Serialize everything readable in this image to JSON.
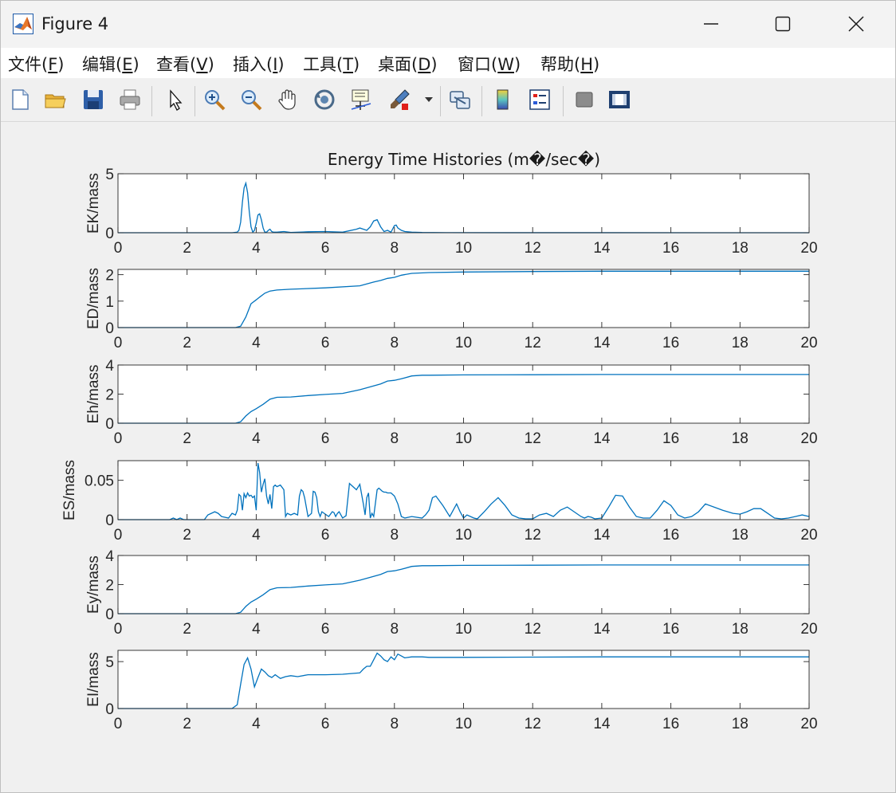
{
  "window": {
    "title": "Figure 4",
    "minimize_icon": "minimize-icon",
    "maximize_icon": "maximize-icon",
    "close_icon": "close-icon"
  },
  "menu": {
    "items": [
      {
        "label": "文件(F)",
        "text": "文件(",
        "key": "F"
      },
      {
        "label": "编辑(E)",
        "text": "编辑(",
        "key": "E"
      },
      {
        "label": "查看(V)",
        "text": "查看(",
        "key": "V"
      },
      {
        "label": "插入(I)",
        "text": "插入(",
        "key": "I"
      },
      {
        "label": "工具(T)",
        "text": "工具(",
        "key": "T"
      },
      {
        "label": "桌面(D)",
        "text": "桌面(",
        "key": "D"
      },
      {
        "label": "窗口(W)",
        "text": "窗口(",
        "key": "W"
      },
      {
        "label": "帮助(H)",
        "text": "帮助(",
        "key": "H"
      }
    ],
    "close_paren": ")",
    "dock_arrow": "↘"
  },
  "toolbar": {
    "icons": [
      "new-figure-icon",
      "open-file-icon",
      "save-icon",
      "print-icon",
      "select-pointer-icon",
      "zoom-in-icon",
      "zoom-out-icon",
      "pan-hand-icon",
      "rotate-3d-icon",
      "data-cursor-icon",
      "brush-icon",
      "link-plot-icon",
      "colorbar-icon",
      "legend-icon",
      "hide-plot-tools-icon",
      "show-plot-tools-icon"
    ]
  },
  "colors": {
    "line": "#0072bd",
    "axes_background": "#ffffff",
    "figure_background": "#f0f0f0",
    "axis": "#262626"
  },
  "chart_data": {
    "type": "line",
    "title": "Energy Time Histories (m�/sec�)",
    "panels": [
      {
        "ylabel": "EK/mass",
        "xlim": [
          0,
          20
        ],
        "ylim": [
          0,
          5
        ],
        "xticks": [
          0,
          2,
          4,
          6,
          8,
          10,
          12,
          14,
          16,
          18,
          20
        ],
        "yticks": [
          0,
          5
        ],
        "ytick_labels": [
          "0",
          "5"
        ],
        "x": [
          0,
          3.3,
          3.45,
          3.5,
          3.55,
          3.6,
          3.65,
          3.7,
          3.75,
          3.8,
          3.85,
          3.9,
          3.95,
          4.0,
          4.05,
          4.1,
          4.15,
          4.2,
          4.25,
          4.3,
          4.35,
          4.4,
          4.45,
          4.5,
          4.6,
          4.8,
          5.0,
          5.5,
          6.0,
          6.5,
          6.9,
          7.0,
          7.2,
          7.3,
          7.4,
          7.5,
          7.6,
          7.7,
          7.8,
          7.9,
          8.0,
          8.05,
          8.1,
          8.2,
          8.3,
          8.5,
          8.8,
          9.5,
          20
        ],
        "y": [
          0,
          0,
          0.05,
          0.2,
          0.9,
          2.6,
          3.8,
          4.2,
          3.4,
          1.8,
          0.5,
          0.05,
          0.2,
          0.8,
          1.5,
          1.6,
          1.1,
          0.4,
          0.05,
          0.05,
          0.2,
          0.3,
          0.1,
          0.05,
          0.05,
          0.1,
          0.03,
          0.08,
          0.1,
          0.05,
          0.3,
          0.4,
          0.2,
          0.5,
          1.0,
          1.1,
          0.5,
          0.1,
          0.2,
          0.05,
          0.6,
          0.65,
          0.4,
          0.2,
          0.1,
          0.05,
          0.02,
          0.01,
          0
        ]
      },
      {
        "ylabel": "ED/mass",
        "xlim": [
          0,
          20
        ],
        "ylim": [
          0,
          2.2
        ],
        "xticks": [
          0,
          2,
          4,
          6,
          8,
          10,
          12,
          14,
          16,
          18,
          20
        ],
        "yticks": [
          0,
          1,
          2
        ],
        "ytick_labels": [
          "0",
          "1",
          "2"
        ],
        "x": [
          0,
          3.4,
          3.55,
          3.7,
          3.85,
          4.0,
          4.1,
          4.25,
          4.4,
          4.6,
          5.0,
          6.0,
          7.0,
          7.2,
          7.4,
          7.6,
          7.8,
          8.0,
          8.2,
          8.5,
          9.0,
          10.0,
          12.0,
          14.0,
          20
        ],
        "y": [
          0,
          0,
          0.05,
          0.4,
          0.9,
          1.05,
          1.15,
          1.3,
          1.38,
          1.42,
          1.45,
          1.5,
          1.58,
          1.65,
          1.72,
          1.78,
          1.86,
          1.9,
          1.98,
          2.05,
          2.08,
          2.1,
          2.12,
          2.13,
          2.13
        ]
      },
      {
        "ylabel": "Eh/mass",
        "xlim": [
          0,
          20
        ],
        "ylim": [
          0,
          4
        ],
        "xticks": [
          0,
          2,
          4,
          6,
          8,
          10,
          12,
          14,
          16,
          18,
          20
        ],
        "yticks": [
          0,
          2,
          4
        ],
        "ytick_labels": [
          "0",
          "2",
          "4"
        ],
        "x": [
          0,
          3.4,
          3.55,
          3.7,
          3.85,
          4.0,
          4.2,
          4.4,
          4.6,
          5.0,
          5.5,
          6.0,
          6.5,
          7.0,
          7.3,
          7.6,
          7.8,
          8.0,
          8.2,
          8.5,
          8.8,
          9.0,
          10.0,
          12.0,
          14.0,
          20
        ],
        "y": [
          0,
          0,
          0.1,
          0.5,
          0.8,
          1.0,
          1.3,
          1.65,
          1.78,
          1.8,
          1.9,
          1.98,
          2.05,
          2.3,
          2.5,
          2.7,
          2.9,
          2.95,
          3.05,
          3.25,
          3.3,
          3.3,
          3.32,
          3.33,
          3.35,
          3.35
        ]
      },
      {
        "ylabel": "ES/mass",
        "xlim": [
          0,
          20
        ],
        "ylim": [
          0,
          0.075
        ],
        "xticks": [
          0,
          2,
          4,
          6,
          8,
          10,
          12,
          14,
          16,
          18,
          20
        ],
        "yticks": [
          0,
          0.05
        ],
        "ytick_labels": [
          "0",
          "0.05"
        ],
        "x": [
          0,
          1.5,
          1.6,
          1.7,
          1.8,
          1.9,
          2.5,
          2.6,
          2.8,
          2.9,
          3.0,
          3.2,
          3.3,
          3.4,
          3.45,
          3.5,
          3.55,
          3.6,
          3.65,
          3.7,
          3.75,
          3.8,
          3.85,
          3.9,
          3.95,
          4.0,
          4.05,
          4.1,
          4.15,
          4.2,
          4.25,
          4.3,
          4.35,
          4.4,
          4.45,
          4.5,
          4.55,
          4.6,
          4.7,
          4.8,
          4.85,
          4.9,
          5.0,
          5.1,
          5.2,
          5.25,
          5.3,
          5.35,
          5.4,
          5.5,
          5.6,
          5.65,
          5.7,
          5.75,
          5.8,
          5.85,
          5.9,
          6.0,
          6.1,
          6.2,
          6.25,
          6.3,
          6.35,
          6.4,
          6.5,
          6.6,
          6.7,
          6.75,
          6.8,
          6.9,
          7.0,
          7.1,
          7.15,
          7.2,
          7.25,
          7.3,
          7.35,
          7.4,
          7.5,
          7.55,
          7.6,
          7.65,
          7.7,
          7.75,
          7.8,
          7.9,
          8.0,
          8.1,
          8.2,
          8.3,
          8.5,
          8.8,
          8.9,
          9.0,
          9.1,
          9.2,
          9.4,
          9.6,
          9.7,
          9.8,
          9.9,
          10.0,
          10.1,
          10.2,
          10.3,
          10.4,
          10.6,
          10.8,
          11.0,
          11.2,
          11.4,
          11.6,
          11.8,
          12.0,
          12.2,
          12.4,
          12.6,
          12.8,
          13.0,
          13.2,
          13.4,
          13.5,
          13.6,
          13.7,
          13.8,
          14.0,
          14.2,
          14.4,
          14.6,
          14.8,
          15.0,
          15.2,
          15.4,
          15.6,
          15.8,
          16.0,
          16.2,
          16.4,
          16.6,
          16.8,
          17.0,
          17.5,
          17.8,
          18.0,
          18.2,
          18.4,
          18.6,
          18.8,
          19.0,
          19.2,
          19.4,
          19.6,
          19.8,
          20
        ],
        "y": [
          0,
          0,
          0.002,
          0,
          0.002,
          0,
          0,
          0.006,
          0.01,
          0.008,
          0.004,
          0.002,
          0.008,
          0.006,
          0.012,
          0.032,
          0.03,
          0.012,
          0.033,
          0.028,
          0.034,
          0.03,
          0.031,
          0.028,
          0.03,
          0.012,
          0.072,
          0.06,
          0.035,
          0.045,
          0.052,
          0.03,
          0.02,
          0.032,
          0.014,
          0.042,
          0.044,
          0.042,
          0.044,
          0.038,
          0.004,
          0.008,
          0.006,
          0.008,
          0.006,
          0.03,
          0.038,
          0.036,
          0.028,
          0.004,
          0.008,
          0.036,
          0.035,
          0.028,
          0.01,
          0.004,
          0.01,
          0.007,
          0.004,
          0.01,
          0.009,
          0.004,
          0.008,
          0.01,
          0.002,
          0.005,
          0.046,
          0.044,
          0.042,
          0.038,
          0.045,
          0.02,
          0.006,
          0.028,
          0.034,
          0.002,
          0.008,
          0.004,
          0.038,
          0.04,
          0.038,
          0.036,
          0.035,
          0.035,
          0.034,
          0.034,
          0.03,
          0.02,
          0.004,
          0.002,
          0.004,
          0.002,
          0.006,
          0.012,
          0.028,
          0.03,
          0.018,
          0.004,
          0.012,
          0.02,
          0.01,
          0.002,
          0.006,
          0.004,
          0.002,
          0.001,
          0.01,
          0.02,
          0.028,
          0.018,
          0.006,
          0.002,
          0.001,
          0.001,
          0.006,
          0.008,
          0.004,
          0.012,
          0.016,
          0.01,
          0.004,
          0.002,
          0.004,
          0.003,
          0.001,
          0.002,
          0.016,
          0.031,
          0.03,
          0.016,
          0.004,
          0.002,
          0.002,
          0.012,
          0.024,
          0.018,
          0.006,
          0.002,
          0.004,
          0.01,
          0.02,
          0.012,
          0.008,
          0.007,
          0.01,
          0.014,
          0.014,
          0.008,
          0.002,
          0.001,
          0.002,
          0.004,
          0.006,
          0.004,
          0.008,
          0.014,
          0.012
        ]
      },
      {
        "ylabel": "Ey/mass",
        "xlim": [
          0,
          20
        ],
        "ylim": [
          0,
          4
        ],
        "xticks": [
          0,
          2,
          4,
          6,
          8,
          10,
          12,
          14,
          16,
          18,
          20
        ],
        "yticks": [
          0,
          2,
          4
        ],
        "ytick_labels": [
          "0",
          "2",
          "4"
        ],
        "x": [
          0,
          3.4,
          3.55,
          3.7,
          3.85,
          4.0,
          4.2,
          4.4,
          4.6,
          5.0,
          5.5,
          6.0,
          6.5,
          7.0,
          7.3,
          7.6,
          7.8,
          8.0,
          8.2,
          8.5,
          8.8,
          9.0,
          10.0,
          12.0,
          14.0,
          20
        ],
        "y": [
          0,
          0,
          0.1,
          0.5,
          0.8,
          1.0,
          1.3,
          1.65,
          1.78,
          1.8,
          1.9,
          1.98,
          2.05,
          2.3,
          2.5,
          2.7,
          2.9,
          2.95,
          3.05,
          3.25,
          3.3,
          3.3,
          3.32,
          3.33,
          3.35,
          3.35
        ]
      },
      {
        "ylabel": "EI/mass",
        "xlim": [
          0,
          20
        ],
        "ylim": [
          0,
          6.2
        ],
        "xticks": [
          0,
          2,
          4,
          6,
          8,
          10,
          12,
          14,
          16,
          18,
          20
        ],
        "yticks": [
          0,
          5
        ],
        "ytick_labels": [
          "0",
          "5"
        ],
        "x": [
          0,
          3.3,
          3.45,
          3.55,
          3.65,
          3.75,
          3.85,
          3.95,
          4.05,
          4.15,
          4.25,
          4.35,
          4.45,
          4.55,
          4.7,
          4.85,
          5.0,
          5.2,
          5.5,
          6.0,
          6.5,
          7.0,
          7.1,
          7.2,
          7.3,
          7.4,
          7.5,
          7.6,
          7.7,
          7.8,
          7.9,
          8.0,
          8.1,
          8.2,
          8.3,
          8.5,
          8.8,
          9.0,
          10.0,
          12.0,
          14.0,
          20
        ],
        "y": [
          0,
          0,
          0.4,
          2.6,
          4.7,
          5.4,
          4.2,
          2.3,
          3.3,
          4.2,
          3.9,
          3.5,
          3.3,
          3.6,
          3.2,
          3.4,
          3.5,
          3.4,
          3.6,
          3.6,
          3.65,
          3.8,
          4.2,
          4.5,
          4.5,
          5.2,
          5.9,
          5.6,
          5.2,
          5.0,
          5.5,
          5.2,
          5.8,
          5.6,
          5.4,
          5.5,
          5.5,
          5.45,
          5.45,
          5.48,
          5.5,
          5.5
        ]
      }
    ]
  }
}
